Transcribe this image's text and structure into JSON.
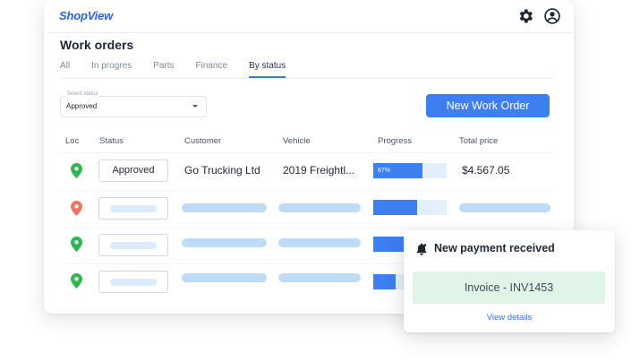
{
  "app": {
    "logo_text": "ShopView"
  },
  "header": {
    "icons": [
      {
        "name": "settings-icon"
      },
      {
        "name": "account-icon"
      }
    ]
  },
  "page": {
    "title": "Work orders"
  },
  "tabs": [
    {
      "label": "All",
      "active": false
    },
    {
      "label": "In progres",
      "active": false
    },
    {
      "label": "Parts",
      "active": false
    },
    {
      "label": "Finance",
      "active": false
    },
    {
      "label": "By status",
      "active": true
    }
  ],
  "status_select": {
    "caption": "Select status",
    "value": "Approved"
  },
  "new_order_button": {
    "label": "New Work Order"
  },
  "table": {
    "columns": [
      "Loc",
      "Status",
      "Customer",
      "Vehicle",
      "Progress",
      "Total price"
    ],
    "rows": [
      {
        "pin_color": "#2fb64f",
        "status": "Approved",
        "customer": "Go Trucking Ltd",
        "vehicle": "2019 Freightl...",
        "progress": 67,
        "progress_label": "67%",
        "total": "$4.567.05"
      },
      {
        "pin_color": "#e8775f",
        "status": "",
        "customer": "",
        "vehicle": "",
        "progress": 60,
        "progress_label": "",
        "total": ""
      },
      {
        "pin_color": "#2fb64f",
        "status": "",
        "customer": "",
        "vehicle": "",
        "progress": 60,
        "progress_label": "",
        "total": ""
      },
      {
        "pin_color": "#2fb64f",
        "status": "",
        "customer": "",
        "vehicle": "",
        "progress": 30,
        "progress_label": "",
        "total": ""
      }
    ]
  },
  "notification": {
    "title": "New payment received",
    "invoice": "Invoice - INV1453",
    "link": "View details",
    "icon": "bell-icon"
  },
  "colors": {
    "accent": "#3d7ef0",
    "skeleton": "#bedcf8",
    "success_bg": "#e1f4e8",
    "link": "#3d6fd9"
  }
}
